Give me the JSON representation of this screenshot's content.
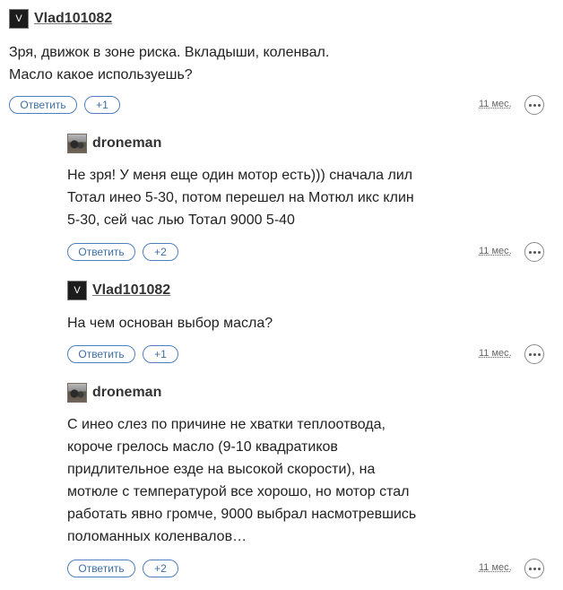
{
  "comments": [
    {
      "avatar_letter": "V",
      "author": "Vlad101082",
      "text_lines": [
        "Зря, движок в зоне риска. Вкладыши, коленвал.",
        "Масло какое используешь?"
      ],
      "reply_label": "Ответить",
      "plus_label": "+1",
      "time": "11 мес."
    },
    {
      "avatar_letter": "",
      "author": "droneman",
      "text_lines": [
        "Не зря! У меня еще один мотор есть))) сначала лил",
        "Тотал инео 5-30, потом перешел на Мотюл икс клин",
        "5-30, сей час лью Тотал 9000 5-40"
      ],
      "reply_label": "Ответить",
      "plus_label": "+2",
      "time": "11 мес."
    },
    {
      "avatar_letter": "V",
      "author": "Vlad101082",
      "text_lines": [
        "На чем основан выбор масла?"
      ],
      "reply_label": "Ответить",
      "plus_label": "+1",
      "time": "11 мес."
    },
    {
      "avatar_letter": "",
      "author": "droneman",
      "text_lines": [
        "С инео слез по причине не хватки теплоотвода,",
        "короче грелось масло (9-10 квадратиков",
        "придлительное езде на высокой скорости), на",
        "мотюле с температурой все хорошо, но мотор стал",
        "работать явно громче, 9000 выбрал насмотревшись",
        "поломанных коленвалов…"
      ],
      "reply_label": "Ответить",
      "plus_label": "+2",
      "time": "11 мес."
    }
  ]
}
